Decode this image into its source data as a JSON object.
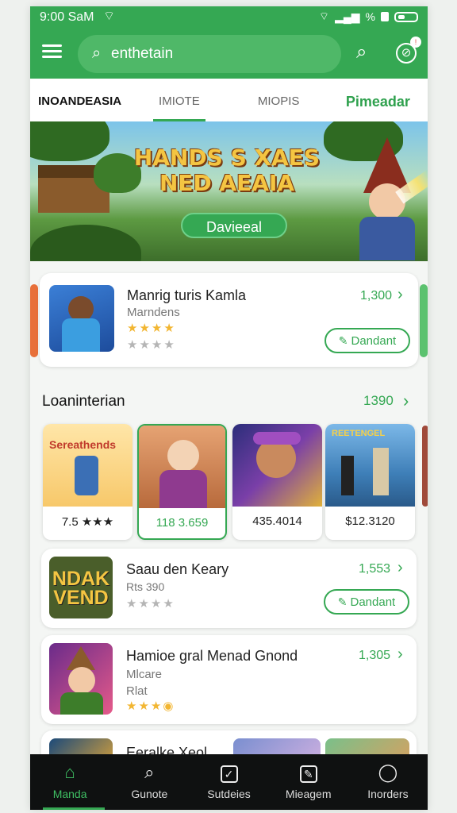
{
  "status": {
    "time": "9:00 SaM",
    "battery_pct": "%"
  },
  "search": {
    "query": "enthetain"
  },
  "tabs": [
    {
      "label": "INOANDEASIA"
    },
    {
      "label": "IMIOTE"
    },
    {
      "label": "MIOPIS"
    },
    {
      "label": "Pimeadar"
    }
  ],
  "banner": {
    "title": "HANDS S XAES NED AEAIA",
    "button": "Davieeal"
  },
  "featured": {
    "title": "Manrig turis Kamla",
    "subtitle": "Marndens",
    "count": "1,300",
    "button": "Dandant",
    "rating": 4
  },
  "section": {
    "title": "Loaninterian",
    "count": "1390"
  },
  "games": [
    {
      "title": "Sereathends",
      "price": "7.5 ★★★"
    },
    {
      "title": "",
      "price": "118 3.659"
    },
    {
      "title": "",
      "price": "435.4014"
    },
    {
      "title": "REETENGEL",
      "price": "$12.3120"
    }
  ],
  "list": [
    {
      "thumb_text": "NDAK VEND",
      "title": "Saau den Keary",
      "subtitle": "Rts 390",
      "count": "1,553",
      "button": "Dandant",
      "rating": 0
    },
    {
      "title": "Hamioe gral Menad Gnond",
      "subtitle": "Mlcare",
      "subtitle2": "Rlat",
      "count": "1,305",
      "rating": 3
    },
    {
      "title": "Eeralke Xeol"
    }
  ],
  "nav": [
    {
      "label": "Manda",
      "icon": "home-icon"
    },
    {
      "label": "Gunote",
      "icon": "search-icon"
    },
    {
      "label": "Sutdeies",
      "icon": "checkbox-icon"
    },
    {
      "label": "Mieagem",
      "icon": "edit-icon"
    },
    {
      "label": "Inorders",
      "icon": "user-icon"
    }
  ],
  "colors": {
    "primary": "#35a853",
    "nav_bg": "#0f1111"
  }
}
